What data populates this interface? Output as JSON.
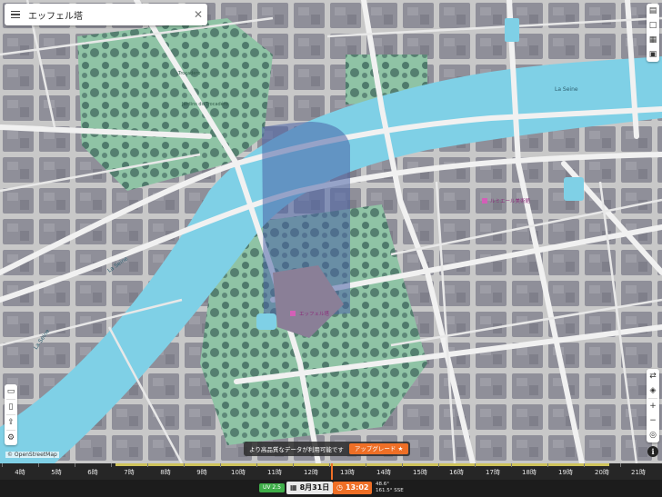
{
  "search": {
    "query": "エッフェル塔"
  },
  "map": {
    "attribution": "© OpenStreetMap",
    "labels": {
      "river_seine": "La Seine",
      "poi_eiffel": "エッフェル塔",
      "poi_museum": "ルミエール美術館",
      "poi_park1": "Trocadero",
      "poi_park2": "Jardins du Trocadéro"
    },
    "colors": {
      "water": "#7fd0e6",
      "land": "#c9c9c9",
      "park": "#8fc3a5",
      "building": "#8c8c96",
      "road": "#f2f2f2",
      "shadow": "#5a6e9c"
    }
  },
  "upsell": {
    "message": "より高品質なデータが利用可能です",
    "button": "アップグレード ★"
  },
  "timeline": {
    "hours": [
      "4時",
      "5時",
      "6時",
      "7時",
      "8時",
      "9時",
      "10時",
      "11時",
      "12時",
      "13時",
      "14時",
      "15時",
      "16時",
      "17時",
      "18時",
      "19時",
      "20時",
      "21時"
    ],
    "current": "13時"
  },
  "status": {
    "uv": "UV 2.5",
    "date": "8月31日",
    "time": "13:02",
    "sun_elevation": "48.6°",
    "sun_azimuth": "161.5° SSE"
  },
  "tools_right_top": [
    "chart-icon",
    "square-icon",
    "calendar-icon",
    "save-icon"
  ],
  "tools_left_bottom": [
    "folder-icon",
    "file-icon",
    "share-icon",
    "settings-icon"
  ],
  "tools_right_bottom": [
    "layers-swap-icon",
    "layers-icon",
    "zoom-in-icon",
    "zoom-out-icon",
    "locate-icon"
  ]
}
